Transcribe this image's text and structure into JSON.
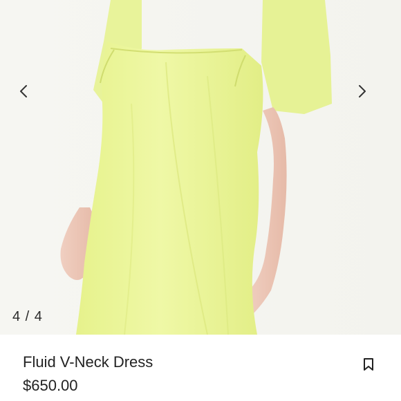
{
  "gallery": {
    "counter": "4 / 4",
    "prev_icon": "chevron-left-icon",
    "next_icon": "chevron-right-icon",
    "dress_color": "#ecf79a"
  },
  "product": {
    "title": "Fluid V-Neck Dress",
    "price": "$650.00",
    "bookmark_icon": "bookmark-icon"
  }
}
